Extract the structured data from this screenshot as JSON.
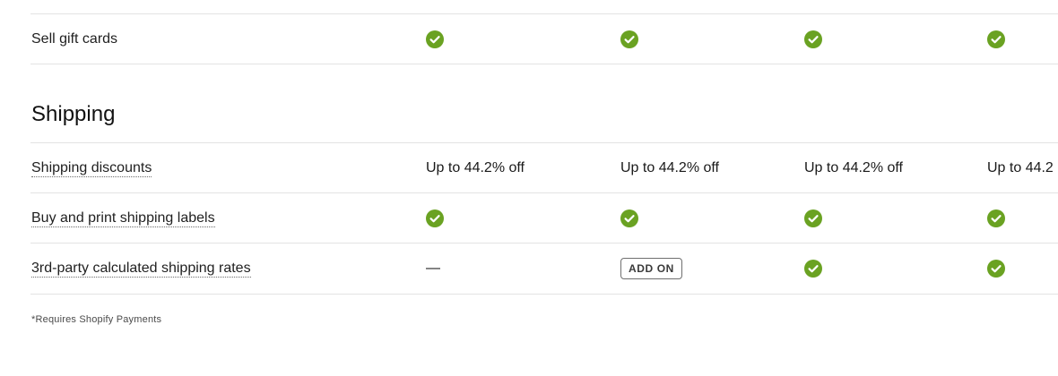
{
  "colors": {
    "check": "#6aa222",
    "border": "#e3e3e3"
  },
  "rows_top": [
    {
      "label": "Sell gift cards",
      "dotted": false,
      "cells": [
        {
          "type": "check",
          "icon": "check-circle-icon"
        },
        {
          "type": "check",
          "icon": "check-circle-icon"
        },
        {
          "type": "check",
          "icon": "check-circle-icon"
        },
        {
          "type": "check",
          "icon": "check-circle-icon"
        }
      ]
    }
  ],
  "shipping": {
    "title": "Shipping",
    "rows": [
      {
        "label": "Shipping discounts",
        "dotted": true,
        "cells": [
          {
            "type": "text",
            "text": "Up to 44.2% off"
          },
          {
            "type": "text",
            "text": "Up to 44.2% off"
          },
          {
            "type": "text",
            "text": "Up to 44.2% off"
          },
          {
            "type": "text",
            "text": "Up to 44.2"
          }
        ]
      },
      {
        "label": "Buy and print shipping labels",
        "dotted": true,
        "cells": [
          {
            "type": "check",
            "icon": "check-circle-icon"
          },
          {
            "type": "check",
            "icon": "check-circle-icon"
          },
          {
            "type": "check",
            "icon": "check-circle-icon"
          },
          {
            "type": "check",
            "icon": "check-circle-icon"
          }
        ]
      },
      {
        "label": "3rd-party calculated shipping rates",
        "dotted": true,
        "cells": [
          {
            "type": "dash",
            "text": "—"
          },
          {
            "type": "badge",
            "text": "ADD ON"
          },
          {
            "type": "check",
            "icon": "check-circle-icon"
          },
          {
            "type": "check",
            "icon": "check-circle-icon"
          }
        ]
      }
    ]
  },
  "footnote": "*Requires Shopify Payments"
}
